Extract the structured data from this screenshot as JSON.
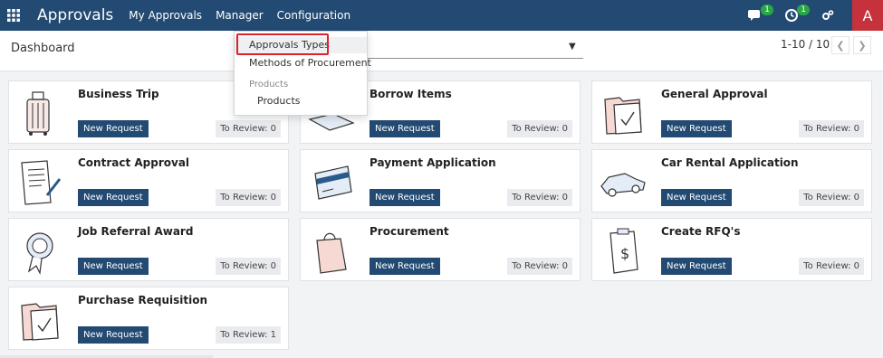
{
  "navbar": {
    "app_title": "Approvals",
    "menu": [
      "My Approvals",
      "Manager",
      "Configuration"
    ],
    "messages_count": "1",
    "activities_count": "1",
    "avatar_letter": "A"
  },
  "control": {
    "breadcrumb": "Dashboard",
    "pager_value": "1-10 / 10"
  },
  "dropdown": {
    "items": [
      "Approvals Types",
      "Methods of Procurement"
    ],
    "section_header": "Products",
    "section_items": [
      "Products"
    ]
  },
  "cards": [
    {
      "title": "Business Trip",
      "new_label": "New Request",
      "review_label": "To Review: 0",
      "icon": "luggage-icon"
    },
    {
      "title": "Borrow Items",
      "new_label": "New Request",
      "review_label": "To Review: 0",
      "icon": "box-icon"
    },
    {
      "title": "General Approval",
      "new_label": "New Request",
      "review_label": "To Review: 0",
      "icon": "folder-check-icon"
    },
    {
      "title": "Contract Approval",
      "new_label": "New Request",
      "review_label": "To Review: 0",
      "icon": "contract-pen-icon"
    },
    {
      "title": "Payment Application",
      "new_label": "New Request",
      "review_label": "To Review: 0",
      "icon": "credit-card-icon"
    },
    {
      "title": "Car Rental Application",
      "new_label": "New Request",
      "review_label": "To Review: 0",
      "icon": "car-icon"
    },
    {
      "title": "Job Referral Award",
      "new_label": "New Request",
      "review_label": "To Review: 0",
      "icon": "award-icon"
    },
    {
      "title": "Procurement",
      "new_label": "New Request",
      "review_label": "To Review: 0",
      "icon": "shopping-bag-icon"
    },
    {
      "title": "Create RFQ's",
      "new_label": "New Request",
      "review_label": "To Review: 0",
      "icon": "clipboard-dollar-icon"
    },
    {
      "title": "Purchase Requisition",
      "new_label": "New Request",
      "review_label": "To Review: 1",
      "icon": "folder-check-icon"
    }
  ],
  "colors": {
    "navbar": "#224a72",
    "new_request_button": "#224a72",
    "avatar": "#c5323b",
    "badge": "#28a745",
    "highlight": "#e0202a"
  }
}
